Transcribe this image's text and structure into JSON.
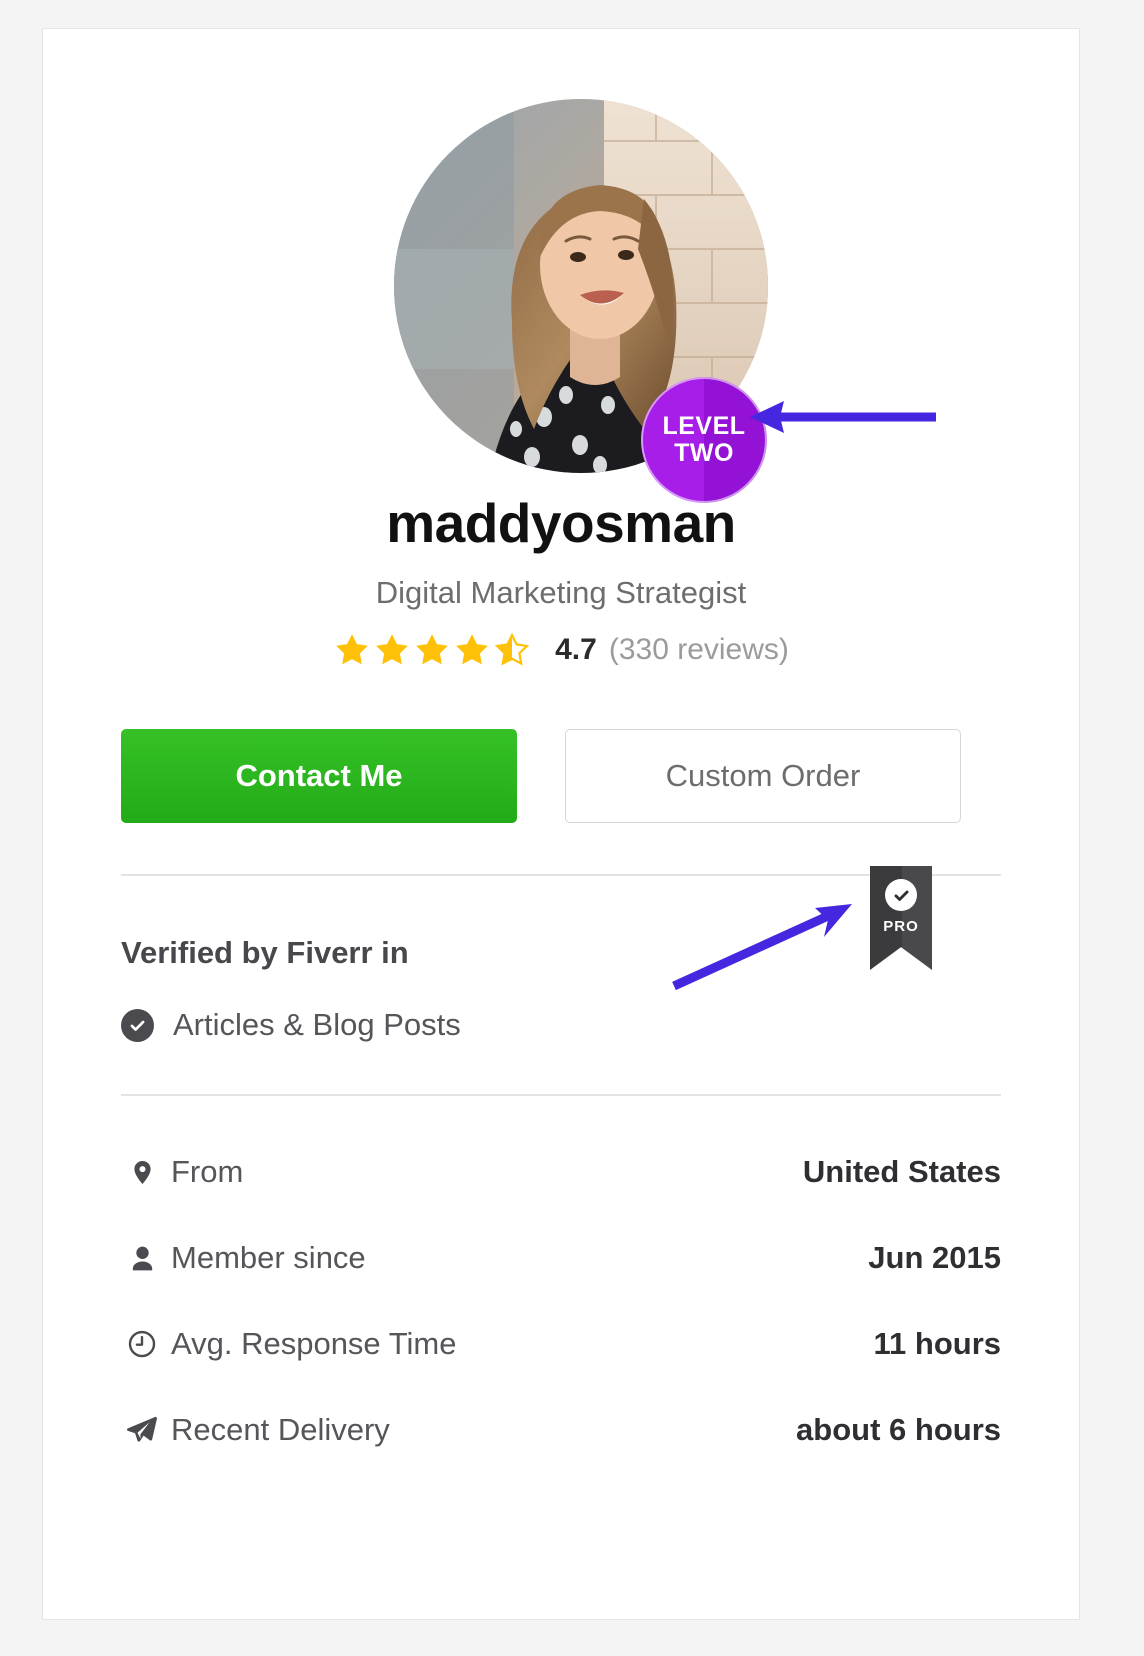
{
  "profile": {
    "username": "maddyosman",
    "tagline": "Digital Marketing Strategist",
    "level_badge": {
      "line1": "LEVEL",
      "line2": "TWO",
      "color": "#a61ee8"
    },
    "pro_badge": {
      "label": "PRO",
      "color": "#3b3b3e"
    }
  },
  "rating": {
    "stars_filled": 4,
    "stars_half": 1,
    "stars_total": 5,
    "score": "4.7",
    "count_text": "(330 reviews)",
    "star_color": "#ffc107"
  },
  "actions": {
    "primary_label": "Contact Me",
    "primary_color": "#27b81b",
    "secondary_label": "Custom Order"
  },
  "verified": {
    "title": "Verified by Fiverr in",
    "items": [
      {
        "label": "Articles & Blog Posts",
        "icon": "check-circle-icon"
      }
    ]
  },
  "info_rows": [
    {
      "icon": "location-pin-icon",
      "label": "From",
      "value": "United States"
    },
    {
      "icon": "person-icon",
      "label": "Member since",
      "value": "Jun 2015"
    },
    {
      "icon": "clock-icon",
      "label": "Avg. Response Time",
      "value": "11 hours"
    },
    {
      "icon": "send-icon",
      "label": "Recent Delivery",
      "value": "about 6 hours"
    }
  ],
  "annotations": {
    "arrow_color": "#4527e0",
    "arrows": [
      {
        "name": "arrow-to-level-badge",
        "target": "level_badge"
      },
      {
        "name": "arrow-to-pro-badge",
        "target": "pro_badge"
      }
    ]
  }
}
